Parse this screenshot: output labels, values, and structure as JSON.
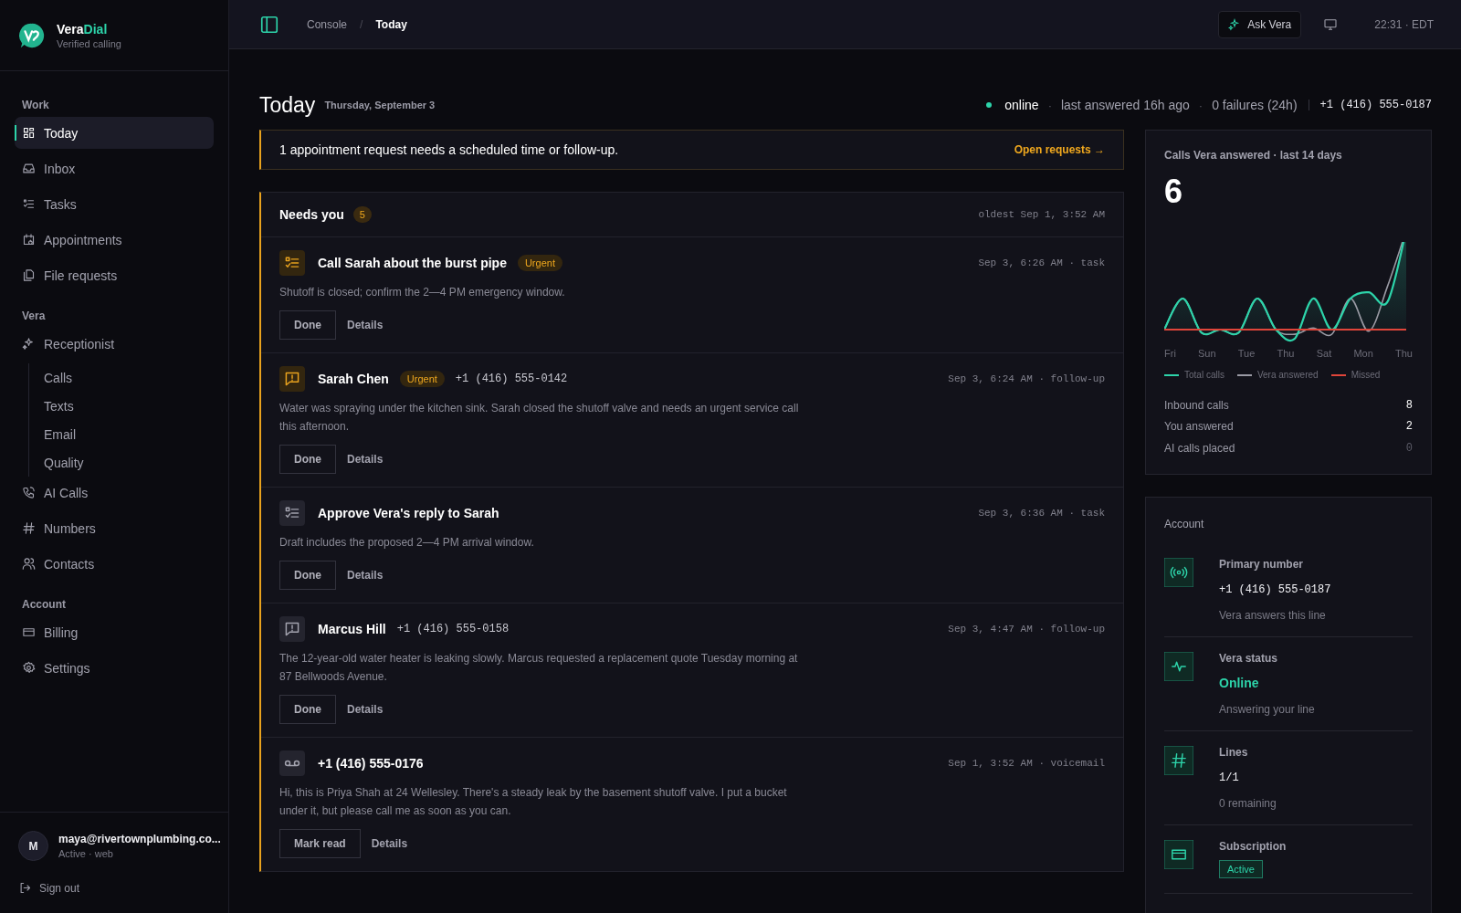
{
  "sidebar": {
    "brand": {
      "name_main": "Vera",
      "name_accent": "Dial",
      "tagline": "Verified calling"
    },
    "sections": [
      {
        "title": "Work",
        "items": [
          {
            "label": "Today",
            "selected": true
          },
          {
            "label": "Inbox",
            "selected": false
          },
          {
            "label": "Tasks",
            "selected": false
          },
          {
            "label": "Appointments",
            "selected": false
          },
          {
            "label": "File requests",
            "selected": false
          }
        ]
      },
      {
        "title": "Vera",
        "items": [
          {
            "label": "Receptionist",
            "selected": false,
            "children": [
              {
                "label": "Calls",
                "selected": false
              },
              {
                "label": "Texts",
                "selected": false
              },
              {
                "label": "Email",
                "selected": false
              },
              {
                "label": "Quality",
                "selected": false
              }
            ]
          },
          {
            "label": "AI Calls",
            "selected": false
          },
          {
            "label": "Numbers",
            "selected": false
          },
          {
            "label": "Contacts",
            "selected": false
          }
        ]
      },
      {
        "title": "Account",
        "items": [
          {
            "label": "Billing",
            "selected": false
          },
          {
            "label": "Settings",
            "selected": false
          }
        ]
      }
    ],
    "user": {
      "initial": "M",
      "email": "maya@rivertownplumbing.co...",
      "status": "Active · web"
    },
    "sign_out": "Sign out"
  },
  "topbar": {
    "breadcrumb": [
      "Console",
      "Today"
    ],
    "separator": "/",
    "ask_button": "Ask Vera",
    "time": "22:31 · EDT"
  },
  "page": {
    "title": "Today",
    "date": "Thursday, September 3",
    "status_items": [
      "online",
      "last answered 16h ago",
      "0 failures (24h)"
    ],
    "status_separator": "·",
    "phone": "+1 (416) 555-0187"
  },
  "alert": {
    "text": "1 appointment request needs a scheduled time or follow-up.",
    "link": "Open requests →"
  },
  "needs_you": {
    "title": "Needs you",
    "count": "5",
    "oldest": "oldest Sep 1, 3:52 AM",
    "items": [
      {
        "kind": "task",
        "title": "Call Sarah about the burst pipe",
        "badge": "Urgent",
        "meta": "Sep 3, 6:26 AM · task",
        "body": "Shutoff is closed; confirm the 2—4 PM emergency window.",
        "actions": [
          "Done",
          "Details"
        ]
      },
      {
        "kind": "follow-up",
        "title": "Sarah Chen",
        "badge": "Urgent",
        "phone": "+1 (416) 555-0142",
        "meta": "Sep 3, 6:24 AM · follow-up",
        "body": "Water was spraying under the kitchen sink. Sarah closed the shutoff valve and needs an urgent service call this afternoon.",
        "actions": [
          "Done",
          "Details"
        ]
      },
      {
        "kind": "task",
        "title": "Approve Vera's reply to Sarah",
        "meta": "Sep 3, 6:36 AM · task",
        "body": "Draft includes the proposed 2—4 PM arrival window.",
        "actions": [
          "Done",
          "Details"
        ]
      },
      {
        "kind": "follow-up",
        "title": "Marcus Hill",
        "phone": "+1 (416) 555-0158",
        "meta": "Sep 3, 4:47 AM · follow-up",
        "body": "The 12-year-old water heater is leaking slowly. Marcus requested a replacement quote Tuesday morning at 87 Bellwoods Avenue.",
        "actions": [
          "Done",
          "Details"
        ]
      },
      {
        "kind": "voicemail",
        "title": "+1 (416) 555-0176",
        "meta": "Sep 1, 3:52 AM · voicemail",
        "body": "Hi, this is Priya Shah at 24 Wellesley. There's a steady leak by the basement shutoff valve. I put a bucket under it, but please call me as soon as you can.",
        "actions": [
          "Mark read",
          "Details"
        ]
      }
    ]
  },
  "calls_card": {
    "title": "Calls Vera answered · last 14 days",
    "total": "6",
    "x_labels": [
      "Fri",
      "Sun",
      "Tue",
      "Thu",
      "Sat",
      "Mon",
      "Thu"
    ],
    "legend": [
      {
        "label": "Total calls",
        "color": "#2dd4aa"
      },
      {
        "label": "Vera answered",
        "color": "#9a9aa4"
      },
      {
        "label": "Missed",
        "color": "#e0453a"
      }
    ],
    "stats": [
      {
        "label": "Inbound calls",
        "value": "8",
        "muted": false
      },
      {
        "label": "You answered",
        "value": "2",
        "muted": false
      },
      {
        "label": "AI calls placed",
        "value": "0",
        "muted": true
      }
    ]
  },
  "account": {
    "title": "Account",
    "items": [
      {
        "kind": "phone",
        "label": "Primary number",
        "value": "+1 (416) 555-0187",
        "note": "Vera answers this line"
      },
      {
        "kind": "status",
        "label": "Vera status",
        "value": "Online",
        "note": "Answering your line"
      },
      {
        "kind": "count",
        "label": "Lines",
        "value": "1/1",
        "note": "0 remaining"
      },
      {
        "kind": "badge",
        "label": "Subscription",
        "value": "Active"
      }
    ]
  }
}
